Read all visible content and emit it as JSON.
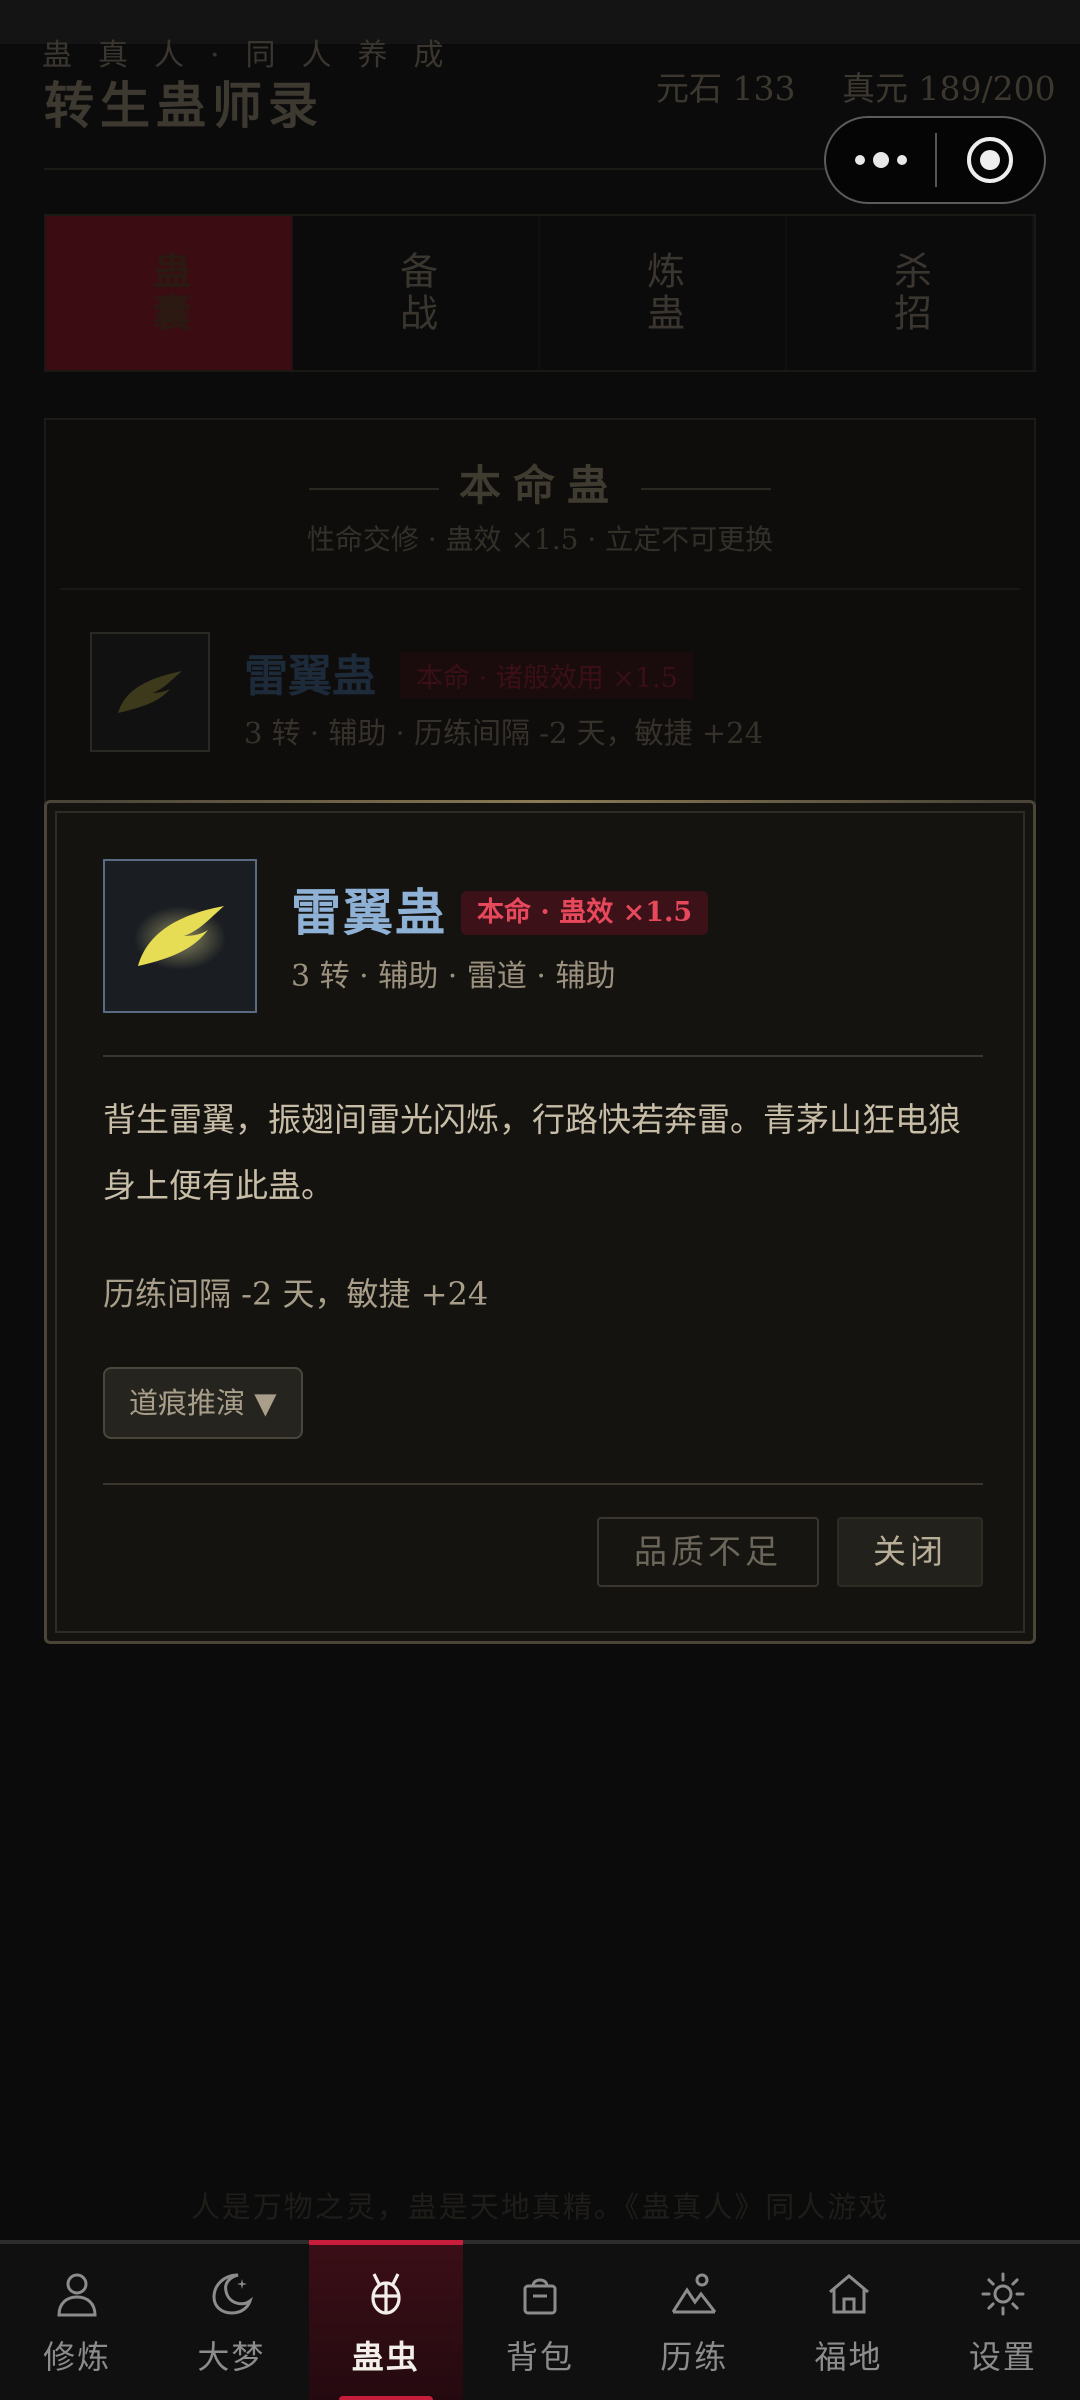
{
  "header": {
    "subtitle": "蛊真人·同人养成",
    "title": "转生蛊师录",
    "stone_label": "元石 133",
    "yuan_label": "真元 189/200"
  },
  "tabs": [
    {
      "label": "蛊囊",
      "active": true
    },
    {
      "label": "备战",
      "active": false
    },
    {
      "label": "炼蛊",
      "active": false
    },
    {
      "label": "杀招",
      "active": false
    }
  ],
  "bg_card": {
    "title": "本命蛊",
    "subtitle": "性命交修 · 蛊效 ×1.5 · 立定不可更换",
    "gu_name": "雷翼蛊",
    "badge": "本命 · 诸般效用 ×1.5",
    "meta": "3 转 · 辅助 · 历练间隔 -2 天，敏捷 +24"
  },
  "modal": {
    "icon": "lightning-wing-icon",
    "gu_name": "雷翼蛊",
    "badge": "本命 · 蛊效 ×1.5",
    "meta": "3 转 · 辅助 · 雷道 · 辅助",
    "description": "背生雷翼，振翅间雷光闪烁，行路快若奔雷。青茅山狂电狼身上便有此蛊。",
    "effect": "历练间隔 -2 天，敏捷 +24",
    "derive_button": "道痕推演 ▼",
    "quality_button": "品质不足",
    "close_button": "关闭"
  },
  "footer_motto": "人是万物之灵，蛊是天地真精。《蛊真人》同人游戏",
  "nav": [
    {
      "label": "修炼",
      "icon": "person-icon",
      "active": false
    },
    {
      "label": "大梦",
      "icon": "moon-icon",
      "active": false
    },
    {
      "label": "蛊虫",
      "icon": "bug-icon",
      "active": true
    },
    {
      "label": "背包",
      "icon": "bag-icon",
      "active": false
    },
    {
      "label": "历练",
      "icon": "mountain-icon",
      "active": false
    },
    {
      "label": "福地",
      "icon": "home-icon",
      "active": false
    },
    {
      "label": "设置",
      "icon": "gear-icon",
      "active": false
    }
  ],
  "colors": {
    "accent_red": "#c81e3c",
    "gu_name_blue": "#8fb1d6",
    "badge_red": "#e8485c",
    "wing_yellow": "#e6dd55"
  }
}
